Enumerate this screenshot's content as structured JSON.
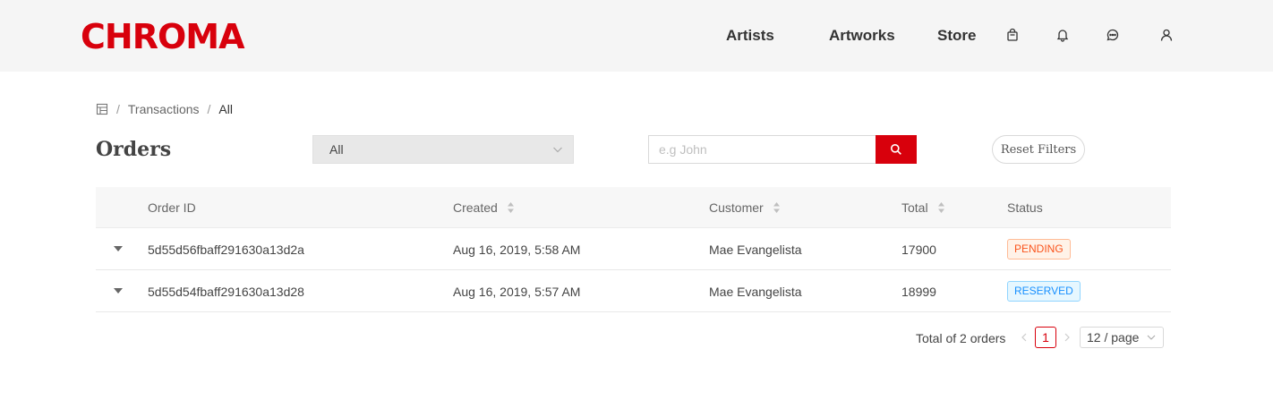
{
  "brand": {
    "logo_text": "CHROMA",
    "accent_color": "#d8000c"
  },
  "nav": {
    "links": [
      "Artists",
      "Artworks",
      "Store"
    ],
    "icons": [
      "shopping-bag-icon",
      "bell-icon",
      "message-icon",
      "user-icon"
    ]
  },
  "breadcrumb": {
    "home_icon": "shop-icon",
    "items": [
      "Transactions",
      "All"
    ],
    "separator": "/"
  },
  "page": {
    "title": "Orders"
  },
  "filters": {
    "status_value": "All",
    "search_placeholder": "e.g John",
    "search_icon": "search-icon",
    "reset_label": "Reset Filters"
  },
  "table": {
    "columns": [
      "Order ID",
      "Created",
      "Customer",
      "Total",
      "Status"
    ],
    "sortable": [
      "Created",
      "Customer",
      "Total"
    ],
    "rows": [
      {
        "order_id": "5d55d56fbaff291630a13d2a",
        "created": "Aug 16, 2019, 5:58 AM",
        "customer": "Mae Evangelista",
        "total": "17900",
        "status": "PENDING",
        "status_color": "#fa541c"
      },
      {
        "order_id": "5d55d54fbaff291630a13d28",
        "created": "Aug 16, 2019, 5:57 AM",
        "customer": "Mae Evangelista",
        "total": "18999",
        "status": "RESERVED",
        "status_color": "#1890ff"
      }
    ]
  },
  "pagination": {
    "total_text": "Total of 2 orders",
    "current_page": "1",
    "page_size": "12 / page"
  }
}
